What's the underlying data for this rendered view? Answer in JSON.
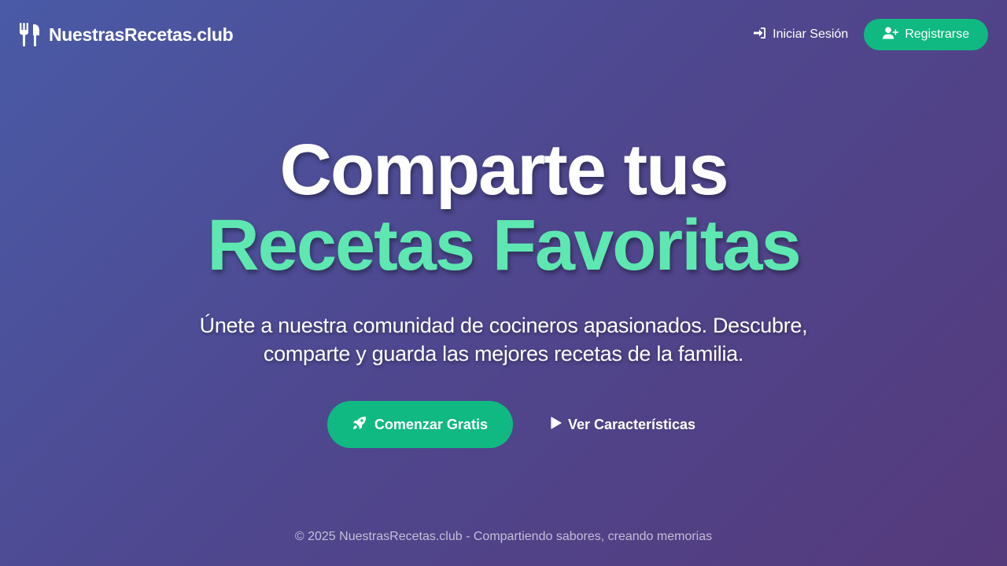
{
  "brand": {
    "name": "NuestrasRecetas.club",
    "icon": "utensils-icon"
  },
  "nav": {
    "login_label": "Iniciar Sesión",
    "login_icon": "sign-in-icon",
    "register_label": "Registrarse",
    "register_icon": "user-plus-icon"
  },
  "hero": {
    "title_line1": "Comparte tus",
    "title_line2": "Recetas Favoritas",
    "subtitle_line1": "Únete a nuestra comunidad de cocineros apasionados. Descubre,",
    "subtitle_line2": "comparte y guarda las mejores recetas de la familia."
  },
  "cta": {
    "primary_label": "Comenzar Gratis",
    "primary_icon": "rocket-icon",
    "secondary_label": "Ver Características",
    "secondary_icon": "play-icon"
  },
  "footer": {
    "text": "© 2025 NuestrasRecetas.club - Compartiendo sabores, creando memorias"
  },
  "colors": {
    "accent": "#10b981",
    "highlight": "#5ee7b0",
    "background_start": "#4a5aa6",
    "background_end": "#553a7c"
  }
}
